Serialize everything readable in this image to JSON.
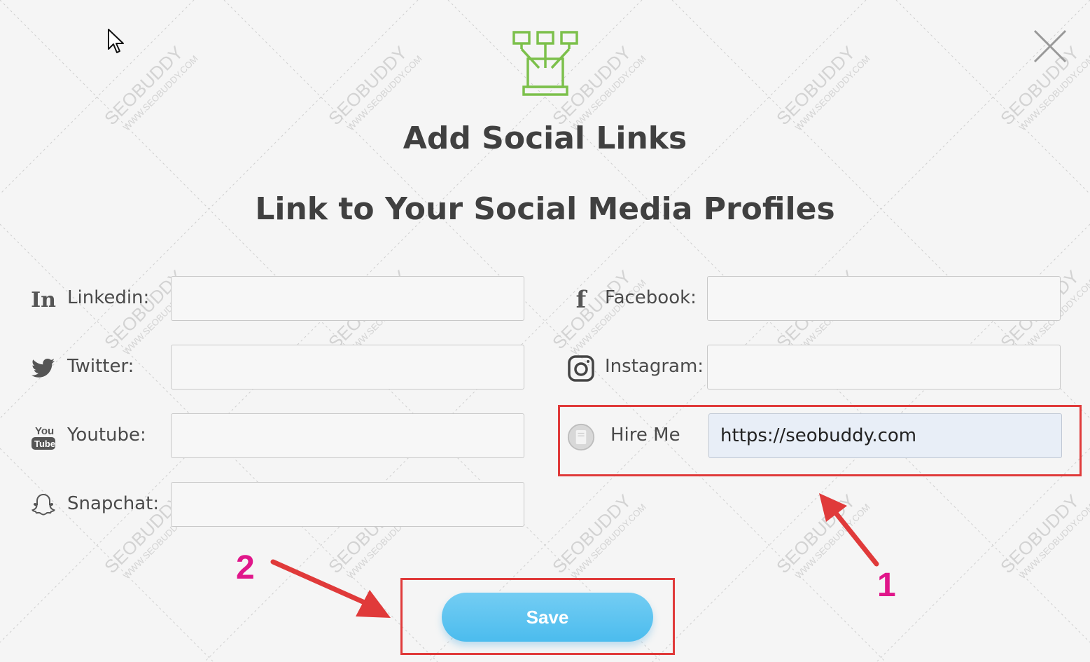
{
  "dialog": {
    "title": "Add Social Links",
    "subtitle": "Link to Your Social Media Profiles"
  },
  "fields_left": [
    {
      "label": "Linkedin:",
      "icon": "linkedin-icon",
      "value": ""
    },
    {
      "label": "Twitter:",
      "icon": "twitter-icon",
      "value": ""
    },
    {
      "label": "Youtube:",
      "icon": "youtube-icon",
      "value": ""
    },
    {
      "label": "Snapchat:",
      "icon": "snapchat-icon",
      "value": ""
    }
  ],
  "fields_right": [
    {
      "label": "Facebook:",
      "icon": "facebook-icon",
      "value": ""
    },
    {
      "label": "Instagram:",
      "icon": "instagram-icon",
      "value": ""
    },
    {
      "label": "Hire Me",
      "icon": "hire-me-icon",
      "value": "https://seobuddy.com"
    }
  ],
  "save_label": "Save",
  "annotations": {
    "label_1": "1",
    "label_2": "2"
  },
  "watermark": {
    "brand": "SEOBUDDY",
    "url": "WWW.SEOBUDDY.COM"
  },
  "colors": {
    "accent_green": "#7cc04b",
    "save_button": "#5cc4f0",
    "annotation_red": "#e03a3a",
    "annotation_number": "#e0168a"
  }
}
